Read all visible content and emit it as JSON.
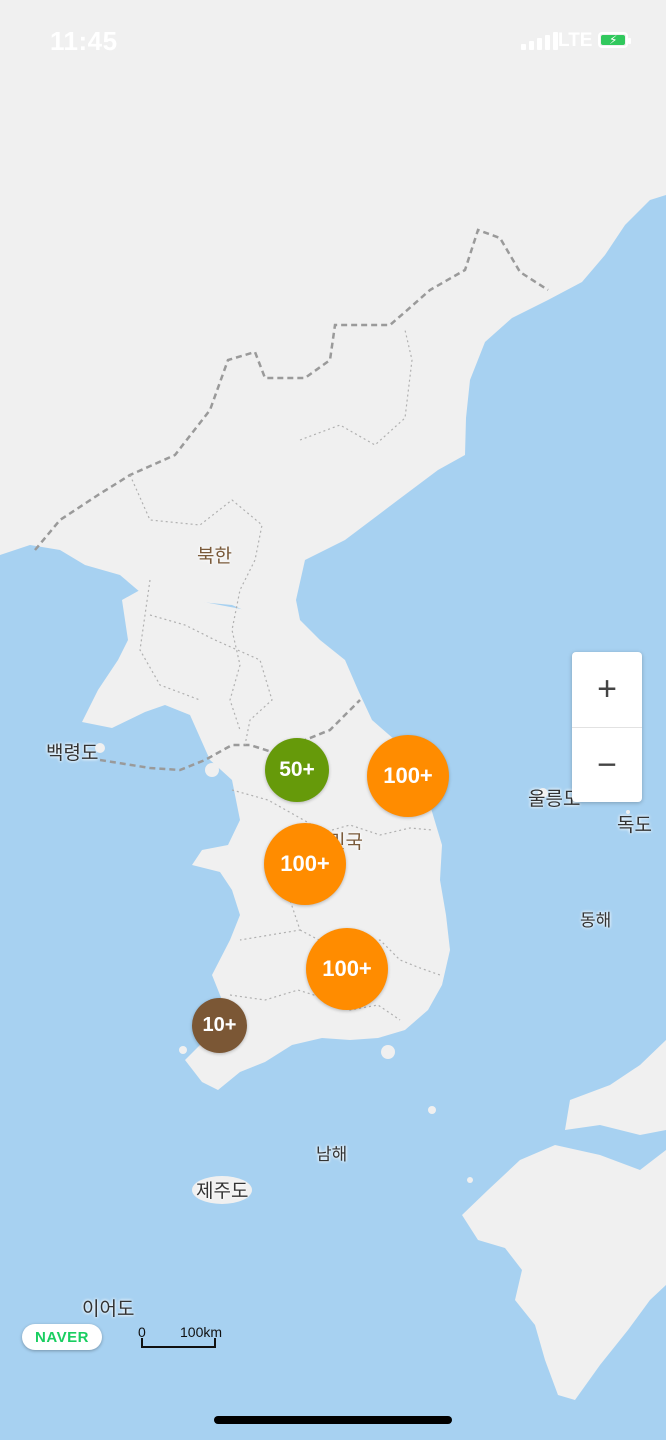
{
  "status_bar": {
    "time": "11:45",
    "network": "LTE"
  },
  "map": {
    "land_color": "#f0f0f0",
    "sea_color": "#a7d1f1",
    "labels": [
      {
        "key": "north_korea",
        "text": "북한"
      },
      {
        "key": "baengnyeongdo",
        "text": "백령도"
      },
      {
        "key": "south_korea",
        "text": "민국"
      },
      {
        "key": "ulleungdo",
        "text": "울릉도"
      },
      {
        "key": "dokdo",
        "text": "독도"
      },
      {
        "key": "east_sea",
        "text": "동해"
      },
      {
        "key": "south_sea",
        "text": "남해"
      },
      {
        "key": "jejudo",
        "text": "제주도"
      },
      {
        "key": "ieodo",
        "text": "이어도"
      }
    ],
    "clusters": [
      {
        "label": "50+",
        "color": "#669a0a"
      },
      {
        "label": "100+",
        "color": "#ff8c00"
      },
      {
        "label": "100+",
        "color": "#ff8c00"
      },
      {
        "label": "100+",
        "color": "#ff8c00"
      },
      {
        "label": "10+",
        "color": "#7b5735"
      }
    ]
  },
  "zoom_control": {
    "zoom_in": "+",
    "zoom_out": "−"
  },
  "attribution": {
    "logo": "NAVER",
    "scale_zero": "0",
    "scale_label": "100km"
  }
}
